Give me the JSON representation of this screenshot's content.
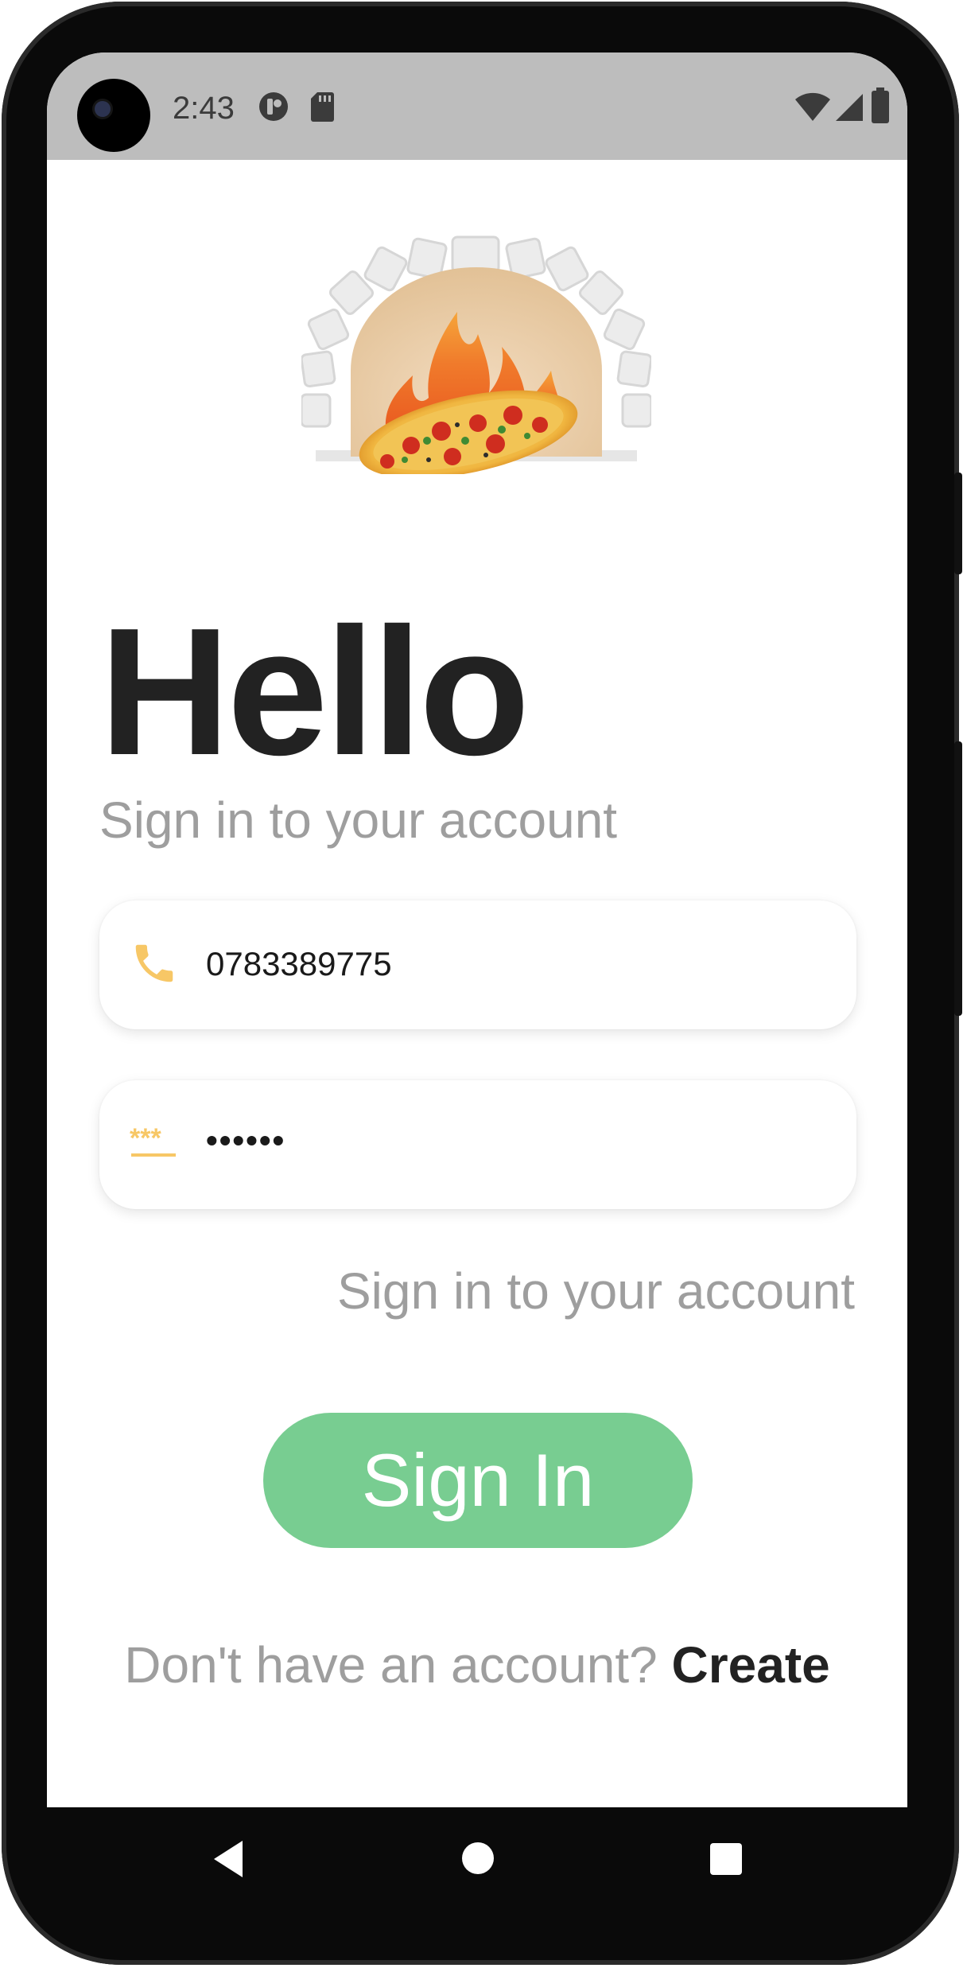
{
  "status_bar": {
    "time": "2:43",
    "icons": [
      "notification-app-icon",
      "sd-card-icon",
      "wifi-icon",
      "signal-icon",
      "battery-icon"
    ]
  },
  "logo": {
    "icon": "pizza-oven-logo-icon"
  },
  "greeting": {
    "title": "Hello",
    "subtitle": "Sign in to your account"
  },
  "form": {
    "phone": {
      "icon": "phone-icon",
      "value": "0783389775"
    },
    "password": {
      "icon": "password-icon",
      "value": "••••••"
    },
    "helper_link": "Sign in to your account"
  },
  "signin_button": {
    "label": "Sign In"
  },
  "footer": {
    "prompt": "Don't have an account? ",
    "link": "Create"
  },
  "nav_bar": {
    "icons": [
      "back-icon",
      "home-icon",
      "recents-icon"
    ]
  },
  "colors": {
    "accent_green": "#78cd91",
    "icon_yellow": "#f7c766",
    "status_bar_gray": "#bdbdbd",
    "title_dark": "#222222",
    "muted_text": "#9e9e9e"
  }
}
